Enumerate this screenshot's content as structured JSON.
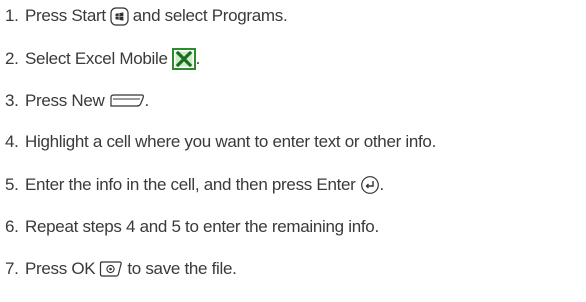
{
  "steps": [
    {
      "number": "1.",
      "before": "Press Start",
      "icon": "start-key-icon",
      "after": "and select Programs."
    },
    {
      "number": "2.",
      "before": "Select Excel Mobile",
      "icon": "excel-mobile-icon",
      "after": "."
    },
    {
      "number": "3.",
      "before": "Press New",
      "icon": "left-softkey-icon",
      "after": "."
    },
    {
      "number": "4.",
      "text": "Highlight a cell where you want to enter text or other info."
    },
    {
      "number": "5.",
      "before": "Enter the info in the cell, and then press Enter",
      "icon": "enter-key-icon",
      "after": "."
    },
    {
      "number": "6.",
      "text": "Repeat steps 4 and 5 to enter the remaining info."
    },
    {
      "number": "7.",
      "before": "Press OK",
      "icon": "ok-key-icon",
      "after": "to save the file."
    }
  ],
  "colors": {
    "text": "#3a3a3a",
    "excel_green": "#2f8a2f"
  }
}
